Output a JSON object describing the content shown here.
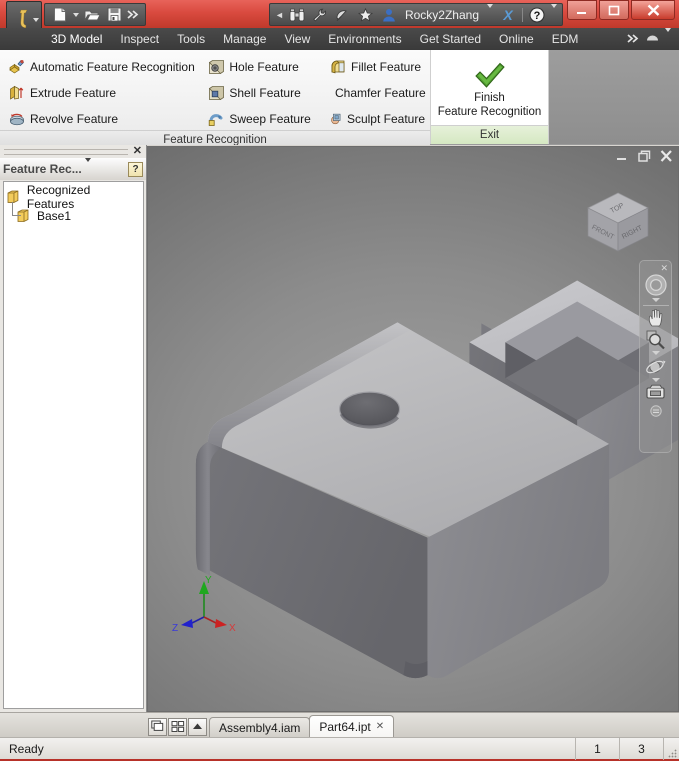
{
  "window": {
    "document_title": "Part64",
    "minimize_label": "—",
    "maximize_label": "❐",
    "close_label": "✕"
  },
  "quick_access": {
    "items": [
      {
        "name": "new-document",
        "icon": "new-document-icon"
      },
      {
        "name": "open-document",
        "icon": "open-folder-icon"
      },
      {
        "name": "save-document",
        "icon": "save-diskette-icon"
      },
      {
        "name": "more-commands",
        "icon": "double-chevron-right-icon"
      }
    ]
  },
  "title_right": {
    "prev_arrow": "◄",
    "search_icon": "binoculars-icon",
    "wrench_icon": "wrench-icon",
    "satellite_icon": "satellite-dish-icon",
    "favorites_icon": "star-icon",
    "user_icon": "user-avatar-icon",
    "username": "Rocky2Zhang",
    "exchange_label": "X",
    "help_label": "?"
  },
  "menu": {
    "items": [
      {
        "label": "3D Model"
      },
      {
        "label": "Inspect"
      },
      {
        "label": "Tools"
      },
      {
        "label": "Manage"
      },
      {
        "label": "View"
      },
      {
        "label": "Environments"
      },
      {
        "label": "Get Started"
      },
      {
        "label": "Online"
      },
      {
        "label": "EDM"
      }
    ],
    "overflow_icon": "double-chevron-right-icon",
    "minimize_ribbon_icon": "ribbon-minimize-icon"
  },
  "ribbon": {
    "feature_recognition_panel": {
      "label": "Feature Recognition",
      "column1": [
        {
          "label": "Automatic Feature Recognition",
          "icon": "auto-feature-icon"
        },
        {
          "label": "Extrude Feature",
          "icon": "extrude-icon"
        },
        {
          "label": "Revolve Feature",
          "icon": "revolve-icon"
        }
      ],
      "column2": [
        {
          "label": "Hole Feature",
          "icon": "hole-icon"
        },
        {
          "label": "Shell Feature",
          "icon": "shell-icon"
        },
        {
          "label": "Sweep Feature",
          "icon": "sweep-icon"
        }
      ],
      "column3": [
        {
          "label": "Fillet Feature",
          "icon": "fillet-icon"
        },
        {
          "label": "Chamfer Feature",
          "icon": "chamfer-icon"
        },
        {
          "label": "Sculpt Feature",
          "icon": "sculpt-icon"
        }
      ]
    },
    "exit_panel": {
      "label": "Exit",
      "button": {
        "line1": "Finish",
        "line2": "Feature Recognition",
        "icon": "green-checkmark-icon"
      }
    }
  },
  "browser": {
    "title": "Feature Rec...",
    "dropdown_icon": "chevron-down-icon",
    "help_label": "?",
    "close_label": "✕",
    "tree": [
      {
        "label": "Recognized Features",
        "icon": "folder-cube-icon",
        "level": 0
      },
      {
        "label": "Base1",
        "icon": "folder-cube-icon",
        "level": 1
      }
    ]
  },
  "viewport": {
    "cube_faces": {
      "top": "TOP",
      "front": "FRONT",
      "right": "RIGHT"
    },
    "triad": {
      "x": "X",
      "y": "Y",
      "z": "Z"
    },
    "nav_items": [
      {
        "name": "steering-wheel-icon"
      },
      {
        "name": "pan-hand-icon"
      },
      {
        "name": "zoom-magnifier-icon"
      },
      {
        "name": "orbit-icon"
      },
      {
        "name": "look-at-camera-icon"
      }
    ],
    "nav_close": "✕",
    "mdi_minimize": "—",
    "mdi_restore": "❐",
    "mdi_close": "✕"
  },
  "tabstrip": {
    "icons": [
      {
        "name": "cascade-windows-icon"
      },
      {
        "name": "tile-windows-icon"
      },
      {
        "name": "scroll-up-icon"
      }
    ],
    "tabs": [
      {
        "label": "Assembly4.iam",
        "active": false,
        "closable": false
      },
      {
        "label": "Part64.ipt",
        "active": true,
        "closable": true,
        "close_label": "✕"
      }
    ]
  },
  "statusbar": {
    "message": "Ready",
    "cell1": "1",
    "cell2": "3"
  },
  "colors": {
    "title_red": "#c0392b",
    "ribbon_bg": "#eaeaea",
    "exit_panel_green": "#d5e8c2",
    "model_gray": "#8d8d8d",
    "axis_x": "#cc2222",
    "axis_y": "#22aa22",
    "axis_z": "#2222cc"
  }
}
